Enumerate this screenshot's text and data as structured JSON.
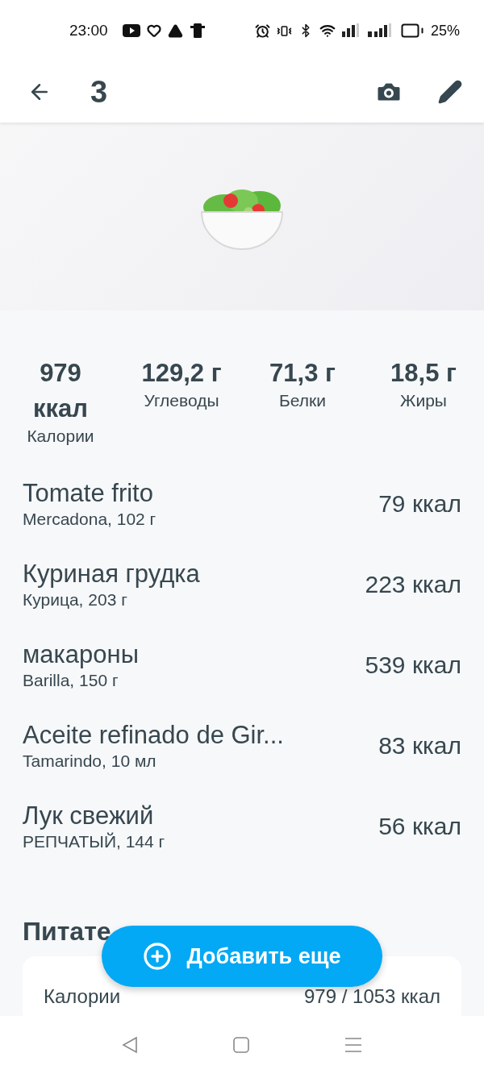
{
  "status_bar": {
    "time": "23:00",
    "battery": "25%"
  },
  "app_bar": {
    "title": "3"
  },
  "summary": [
    {
      "value": "979 ккал",
      "label": "Калории"
    },
    {
      "value": "129,2 г",
      "label": "Углеводы"
    },
    {
      "value": "71,3 г",
      "label": "Белки"
    },
    {
      "value": "18,5 г",
      "label": "Жиры"
    }
  ],
  "foods": [
    {
      "name": "Tomate frito",
      "detail": "Mercadona, 102 г",
      "calories": "79 ккал"
    },
    {
      "name": "Куриная грудка",
      "detail": "Курица, 203 г",
      "calories": "223 ккал"
    },
    {
      "name": "макароны",
      "detail": "Barilla, 150 г",
      "calories": "539 ккал"
    },
    {
      "name": "Aceite refinado de Gir...",
      "detail": "Tamarindo, 10 мл",
      "calories": "83 ккал"
    },
    {
      "name": "Лук свежий",
      "detail": "РЕПЧАТЫЙ, 144 г",
      "calories": "56 ккал"
    }
  ],
  "nutrients": {
    "heading": "Питате",
    "rows": [
      {
        "label": "Калории",
        "value": "979 / 1053 ккал"
      }
    ]
  },
  "fab": {
    "label": "Добавить еще"
  }
}
